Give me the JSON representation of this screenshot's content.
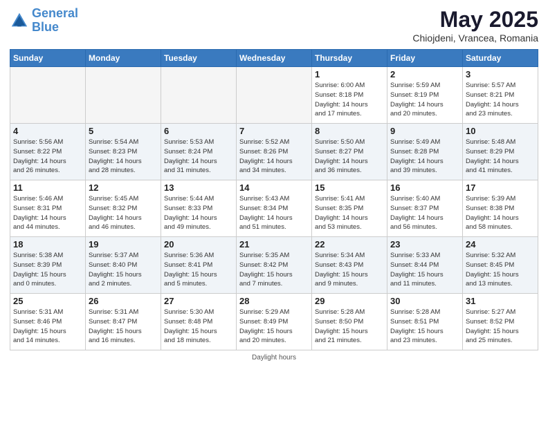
{
  "header": {
    "logo_line1": "General",
    "logo_line2": "Blue",
    "month": "May 2025",
    "location": "Chiojdeni, Vrancea, Romania"
  },
  "weekdays": [
    "Sunday",
    "Monday",
    "Tuesday",
    "Wednesday",
    "Thursday",
    "Friday",
    "Saturday"
  ],
  "weeks": [
    [
      {
        "day": "",
        "info": "",
        "empty": true
      },
      {
        "day": "",
        "info": "",
        "empty": true
      },
      {
        "day": "",
        "info": "",
        "empty": true
      },
      {
        "day": "",
        "info": "",
        "empty": true
      },
      {
        "day": "1",
        "info": "Sunrise: 6:00 AM\nSunset: 8:18 PM\nDaylight: 14 hours\nand 17 minutes."
      },
      {
        "day": "2",
        "info": "Sunrise: 5:59 AM\nSunset: 8:19 PM\nDaylight: 14 hours\nand 20 minutes."
      },
      {
        "day": "3",
        "info": "Sunrise: 5:57 AM\nSunset: 8:21 PM\nDaylight: 14 hours\nand 23 minutes."
      }
    ],
    [
      {
        "day": "4",
        "info": "Sunrise: 5:56 AM\nSunset: 8:22 PM\nDaylight: 14 hours\nand 26 minutes."
      },
      {
        "day": "5",
        "info": "Sunrise: 5:54 AM\nSunset: 8:23 PM\nDaylight: 14 hours\nand 28 minutes."
      },
      {
        "day": "6",
        "info": "Sunrise: 5:53 AM\nSunset: 8:24 PM\nDaylight: 14 hours\nand 31 minutes."
      },
      {
        "day": "7",
        "info": "Sunrise: 5:52 AM\nSunset: 8:26 PM\nDaylight: 14 hours\nand 34 minutes."
      },
      {
        "day": "8",
        "info": "Sunrise: 5:50 AM\nSunset: 8:27 PM\nDaylight: 14 hours\nand 36 minutes."
      },
      {
        "day": "9",
        "info": "Sunrise: 5:49 AM\nSunset: 8:28 PM\nDaylight: 14 hours\nand 39 minutes."
      },
      {
        "day": "10",
        "info": "Sunrise: 5:48 AM\nSunset: 8:29 PM\nDaylight: 14 hours\nand 41 minutes."
      }
    ],
    [
      {
        "day": "11",
        "info": "Sunrise: 5:46 AM\nSunset: 8:31 PM\nDaylight: 14 hours\nand 44 minutes."
      },
      {
        "day": "12",
        "info": "Sunrise: 5:45 AM\nSunset: 8:32 PM\nDaylight: 14 hours\nand 46 minutes."
      },
      {
        "day": "13",
        "info": "Sunrise: 5:44 AM\nSunset: 8:33 PM\nDaylight: 14 hours\nand 49 minutes."
      },
      {
        "day": "14",
        "info": "Sunrise: 5:43 AM\nSunset: 8:34 PM\nDaylight: 14 hours\nand 51 minutes."
      },
      {
        "day": "15",
        "info": "Sunrise: 5:41 AM\nSunset: 8:35 PM\nDaylight: 14 hours\nand 53 minutes."
      },
      {
        "day": "16",
        "info": "Sunrise: 5:40 AM\nSunset: 8:37 PM\nDaylight: 14 hours\nand 56 minutes."
      },
      {
        "day": "17",
        "info": "Sunrise: 5:39 AM\nSunset: 8:38 PM\nDaylight: 14 hours\nand 58 minutes."
      }
    ],
    [
      {
        "day": "18",
        "info": "Sunrise: 5:38 AM\nSunset: 8:39 PM\nDaylight: 15 hours\nand 0 minutes."
      },
      {
        "day": "19",
        "info": "Sunrise: 5:37 AM\nSunset: 8:40 PM\nDaylight: 15 hours\nand 2 minutes."
      },
      {
        "day": "20",
        "info": "Sunrise: 5:36 AM\nSunset: 8:41 PM\nDaylight: 15 hours\nand 5 minutes."
      },
      {
        "day": "21",
        "info": "Sunrise: 5:35 AM\nSunset: 8:42 PM\nDaylight: 15 hours\nand 7 minutes."
      },
      {
        "day": "22",
        "info": "Sunrise: 5:34 AM\nSunset: 8:43 PM\nDaylight: 15 hours\nand 9 minutes."
      },
      {
        "day": "23",
        "info": "Sunrise: 5:33 AM\nSunset: 8:44 PM\nDaylight: 15 hours\nand 11 minutes."
      },
      {
        "day": "24",
        "info": "Sunrise: 5:32 AM\nSunset: 8:45 PM\nDaylight: 15 hours\nand 13 minutes."
      }
    ],
    [
      {
        "day": "25",
        "info": "Sunrise: 5:31 AM\nSunset: 8:46 PM\nDaylight: 15 hours\nand 14 minutes."
      },
      {
        "day": "26",
        "info": "Sunrise: 5:31 AM\nSunset: 8:47 PM\nDaylight: 15 hours\nand 16 minutes."
      },
      {
        "day": "27",
        "info": "Sunrise: 5:30 AM\nSunset: 8:48 PM\nDaylight: 15 hours\nand 18 minutes."
      },
      {
        "day": "28",
        "info": "Sunrise: 5:29 AM\nSunset: 8:49 PM\nDaylight: 15 hours\nand 20 minutes."
      },
      {
        "day": "29",
        "info": "Sunrise: 5:28 AM\nSunset: 8:50 PM\nDaylight: 15 hours\nand 21 minutes."
      },
      {
        "day": "30",
        "info": "Sunrise: 5:28 AM\nSunset: 8:51 PM\nDaylight: 15 hours\nand 23 minutes."
      },
      {
        "day": "31",
        "info": "Sunrise: 5:27 AM\nSunset: 8:52 PM\nDaylight: 15 hours\nand 25 minutes."
      }
    ]
  ],
  "footer": "Daylight hours"
}
